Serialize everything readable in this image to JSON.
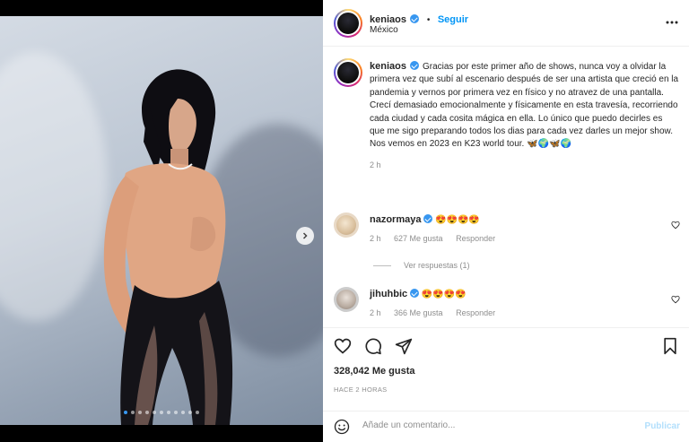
{
  "post": {
    "username": "keniaos",
    "follow_label": "Seguir",
    "location": "México",
    "separator": "•"
  },
  "caption": {
    "username": "keniaos",
    "text": "Gracias por este primer año de shows, nunca voy a olvidar la primera vez que subí al escenario después de ser una artista que creció en la pandemia y vernos por primera vez en físico y no atravez de una pantalla.",
    "text2": "Crecí demasiado emocionalmente y físicamente en esta travesía, recorriendo cada ciudad y cada cosita mágica en ella. Lo único que puedo decirles es que me sigo preparando todos los dias para cada vez darles un mejor show. Nos vemos en 2023 en K23 world tour. 🦋🌍🦋🌍",
    "time": "2 h"
  },
  "comments": [
    {
      "username": "nazormaya",
      "text": "😍😍😍😍",
      "time": "2 h",
      "likes": "627 Me gusta",
      "reply": "Responder",
      "view_replies": "Ver respuestas (1)"
    },
    {
      "username": "jihuhbic",
      "text": "😍😍😍😍",
      "time": "2 h",
      "likes": "366 Me gusta",
      "reply": "Responder"
    }
  ],
  "footer": {
    "likes": "328,042 Me gusta",
    "time_ago": "HACE 2 HORAS",
    "comment_placeholder": "Añade un comentario...",
    "publish_label": "Publicar"
  },
  "carousel": {
    "total": 11,
    "active_index": 0
  },
  "colors": {
    "accent": "#0095f6",
    "verified": "#3897f0",
    "publish_disabled": "#b2dffc"
  },
  "icons": [
    "more-icon",
    "verified-icon",
    "heart-icon",
    "comment-icon",
    "share-icon",
    "bookmark-icon",
    "emoji-icon",
    "chevron-right-icon"
  ]
}
